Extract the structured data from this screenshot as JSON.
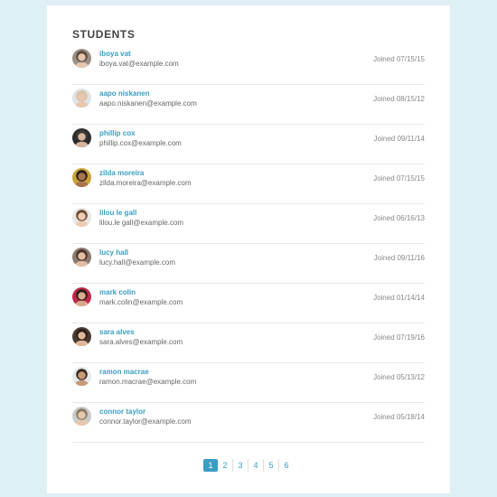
{
  "section_title": "STUDENTS",
  "students": [
    {
      "name": "iboya vat",
      "email": "iboya.vat@example.com",
      "joined": "Joined 07/15/15",
      "bg": "#9a8f86",
      "hair": "#5b4a3f",
      "skin": "#e6c4ad"
    },
    {
      "name": "aapo niskanen",
      "email": "aapo.niskanen@example.com",
      "joined": "Joined 08/15/12",
      "bg": "#dfe3e6",
      "hair": "#d9c2a8",
      "skin": "#e9c6ae"
    },
    {
      "name": "phillip cox",
      "email": "phillip.cox@example.com",
      "joined": "Joined 09/11/14",
      "bg": "#2c2c2c",
      "hair": "#3b3b3b",
      "skin": "#d8b49c"
    },
    {
      "name": "zilda moreira",
      "email": "zilda.moreira@example.com",
      "joined": "Joined 07/15/15",
      "bg": "#c9a23a",
      "hair": "#2b1f17",
      "skin": "#a8754f"
    },
    {
      "name": "lilou le gall",
      "email": "lilou.le gall@example.com",
      "joined": "Joined 06/16/13",
      "bg": "#e9e6e2",
      "hair": "#6b4a33",
      "skin": "#efcbb3"
    },
    {
      "name": "lucy hall",
      "email": "lucy.hall@example.com",
      "joined": "Joined 09/11/16",
      "bg": "#8c7a70",
      "hair": "#4a3326",
      "skin": "#e3bfa5"
    },
    {
      "name": "mark colin",
      "email": "mark.colin@example.com",
      "joined": "Joined 01/14/14",
      "bg": "#c0284a",
      "hair": "#2a1c16",
      "skin": "#d9aa8c"
    },
    {
      "name": "sara alves",
      "email": "sara.alves@example.com",
      "joined": "Joined 07/19/16",
      "bg": "#4a3b33",
      "hair": "#2a1d15",
      "skin": "#e0b89a"
    },
    {
      "name": "ramon macrae",
      "email": "ramon.macrae@example.com",
      "joined": "Joined 05/13/12",
      "bg": "#e5e9ec",
      "hair": "#3a2b22",
      "skin": "#c99a78"
    },
    {
      "name": "connor taylor",
      "email": "connor.taylor@example.com",
      "joined": "Joined 05/18/14",
      "bg": "#c9ccc9",
      "hair": "#8a7a66",
      "skin": "#e7c7ae"
    }
  ],
  "pagination": {
    "pages": [
      "1",
      "2",
      "3",
      "4",
      "5",
      "6"
    ],
    "current": "1",
    "accent": "#3a9ec2"
  }
}
